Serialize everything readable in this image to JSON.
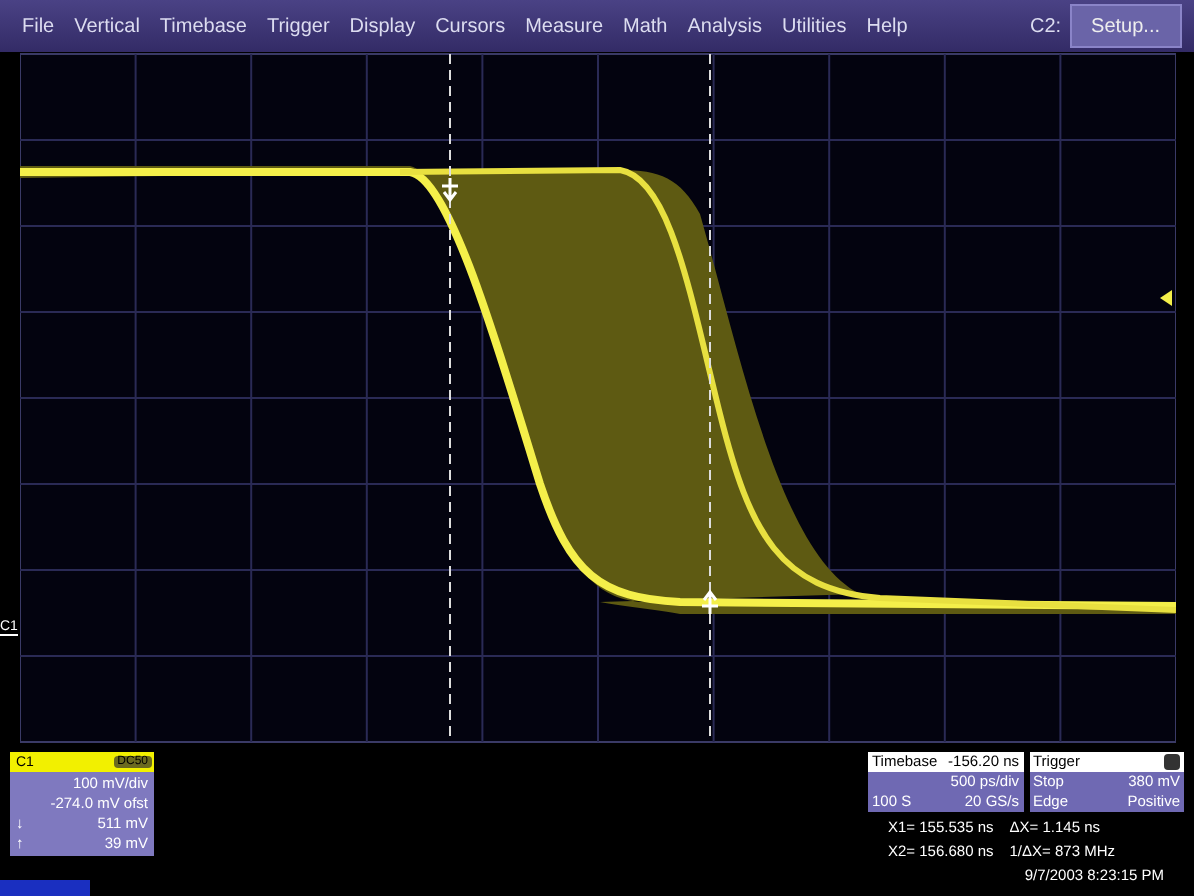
{
  "menu": [
    "File",
    "Vertical",
    "Timebase",
    "Trigger",
    "Display",
    "Cursors",
    "Measure",
    "Math",
    "Analysis",
    "Utilities",
    "Help"
  ],
  "channel_select": "C2:",
  "setup_button": "Setup...",
  "channel_marker": "C1",
  "channel_panel": {
    "label": "C1",
    "coupling": "DC50",
    "lines": [
      "100 mV/div",
      "-274.0 mV ofst"
    ],
    "readouts": [
      {
        "symbol": "↓",
        "value": "511 mV"
      },
      {
        "symbol": "↑",
        "value": "39 mV"
      }
    ]
  },
  "timebase": {
    "label": "Timebase",
    "delay": "-156.20 ns",
    "per_div": "500 ps/div",
    "samples": "100 S",
    "rate": "20 GS/s"
  },
  "trigger": {
    "label": "Trigger",
    "mode": "Stop",
    "level": "380 mV",
    "type": "Edge",
    "slope": "Positive"
  },
  "cursors": [
    {
      "position": "X1= 155.535 ns",
      "delta": "ΔX= 1.145 ns"
    },
    {
      "position": "X2= 156.680 ns",
      "delta": "1/ΔX= 873 MHz"
    }
  ],
  "timestamp": "9/7/2003 8:23:15 PM"
}
